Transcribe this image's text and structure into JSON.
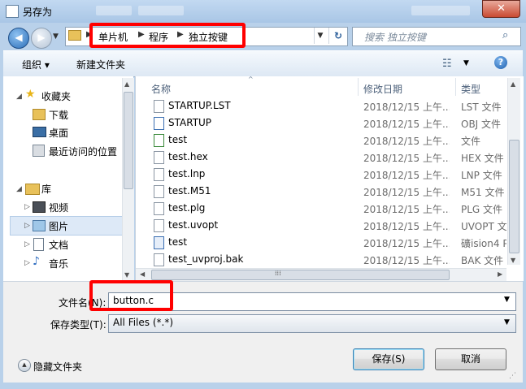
{
  "window": {
    "title": "另存为",
    "close_glyph": "✕",
    "blurred_title_parts": [
      "",
      "",
      ""
    ]
  },
  "nav": {
    "back_glyph": "◀",
    "fwd_glyph": "▶",
    "dropdown_glyph": "▼",
    "crumbs": [
      "单片机",
      "程序",
      "独立按键"
    ],
    "crumb_arrow": "▶",
    "refresh_glyph": "↻"
  },
  "search": {
    "placeholder": "搜索 独立按键",
    "icon": "search-icon",
    "glyph": "⌕"
  },
  "toolbar": {
    "organize": "组织 ▾",
    "new_folder": "新建文件夹",
    "view_glyph": "☷",
    "view_dd": "▼",
    "help": "?"
  },
  "sidebar": {
    "favorites": "收藏夹",
    "fav_items": [
      "下载",
      "桌面",
      "最近访问的位置"
    ],
    "libraries": "库",
    "lib_items": [
      "视频",
      "图片",
      "文档",
      "音乐"
    ],
    "expander_open": "◢",
    "expander_closed": "▷",
    "music_glyph": "♪",
    "star_glyph": "★"
  },
  "columns": {
    "name": "名称",
    "date": "修改日期",
    "type": "类型",
    "sort_glyph": "^"
  },
  "files": [
    {
      "name": "STARTUP.LST",
      "date": "2018/12/15 上午...",
      "type": "LST 文件"
    },
    {
      "name": "STARTUP",
      "date": "2018/12/15 上午...",
      "type": "OBJ 文件"
    },
    {
      "name": "test",
      "date": "2018/12/15 上午...",
      "type": "文件"
    },
    {
      "name": "test.hex",
      "date": "2018/12/15 上午...",
      "type": "HEX 文件"
    },
    {
      "name": "test.lnp",
      "date": "2018/12/15 上午...",
      "type": "LNP 文件"
    },
    {
      "name": "test.M51",
      "date": "2018/12/15 上午...",
      "type": "M51 文件"
    },
    {
      "name": "test.plg",
      "date": "2018/12/15 上午...",
      "type": "PLG 文件"
    },
    {
      "name": "test.uvopt",
      "date": "2018/12/15 上午...",
      "type": "UVOPT 文"
    },
    {
      "name": "test",
      "date": "2018/12/15 上午...",
      "type": "礦ision4 P"
    },
    {
      "name": "test_uvproj.bak",
      "date": "2018/12/15 上午...",
      "type": "BAK 文件"
    }
  ],
  "scroll": {
    "up": "▲",
    "down": "▼",
    "left": "◀",
    "right": "▶",
    "grip": "⁞⁞⁞"
  },
  "form": {
    "filename_label": "文件名(N):",
    "filename_value": "button.c",
    "filetype_label": "保存类型(T):",
    "filetype_value": "All Files (*.*)",
    "dd_glyph": "▼"
  },
  "footer": {
    "hide_folders": "隐藏文件夹",
    "hide_glyph": "▲",
    "save": "保存(S)",
    "cancel": "取消",
    "grip": "⋰"
  }
}
